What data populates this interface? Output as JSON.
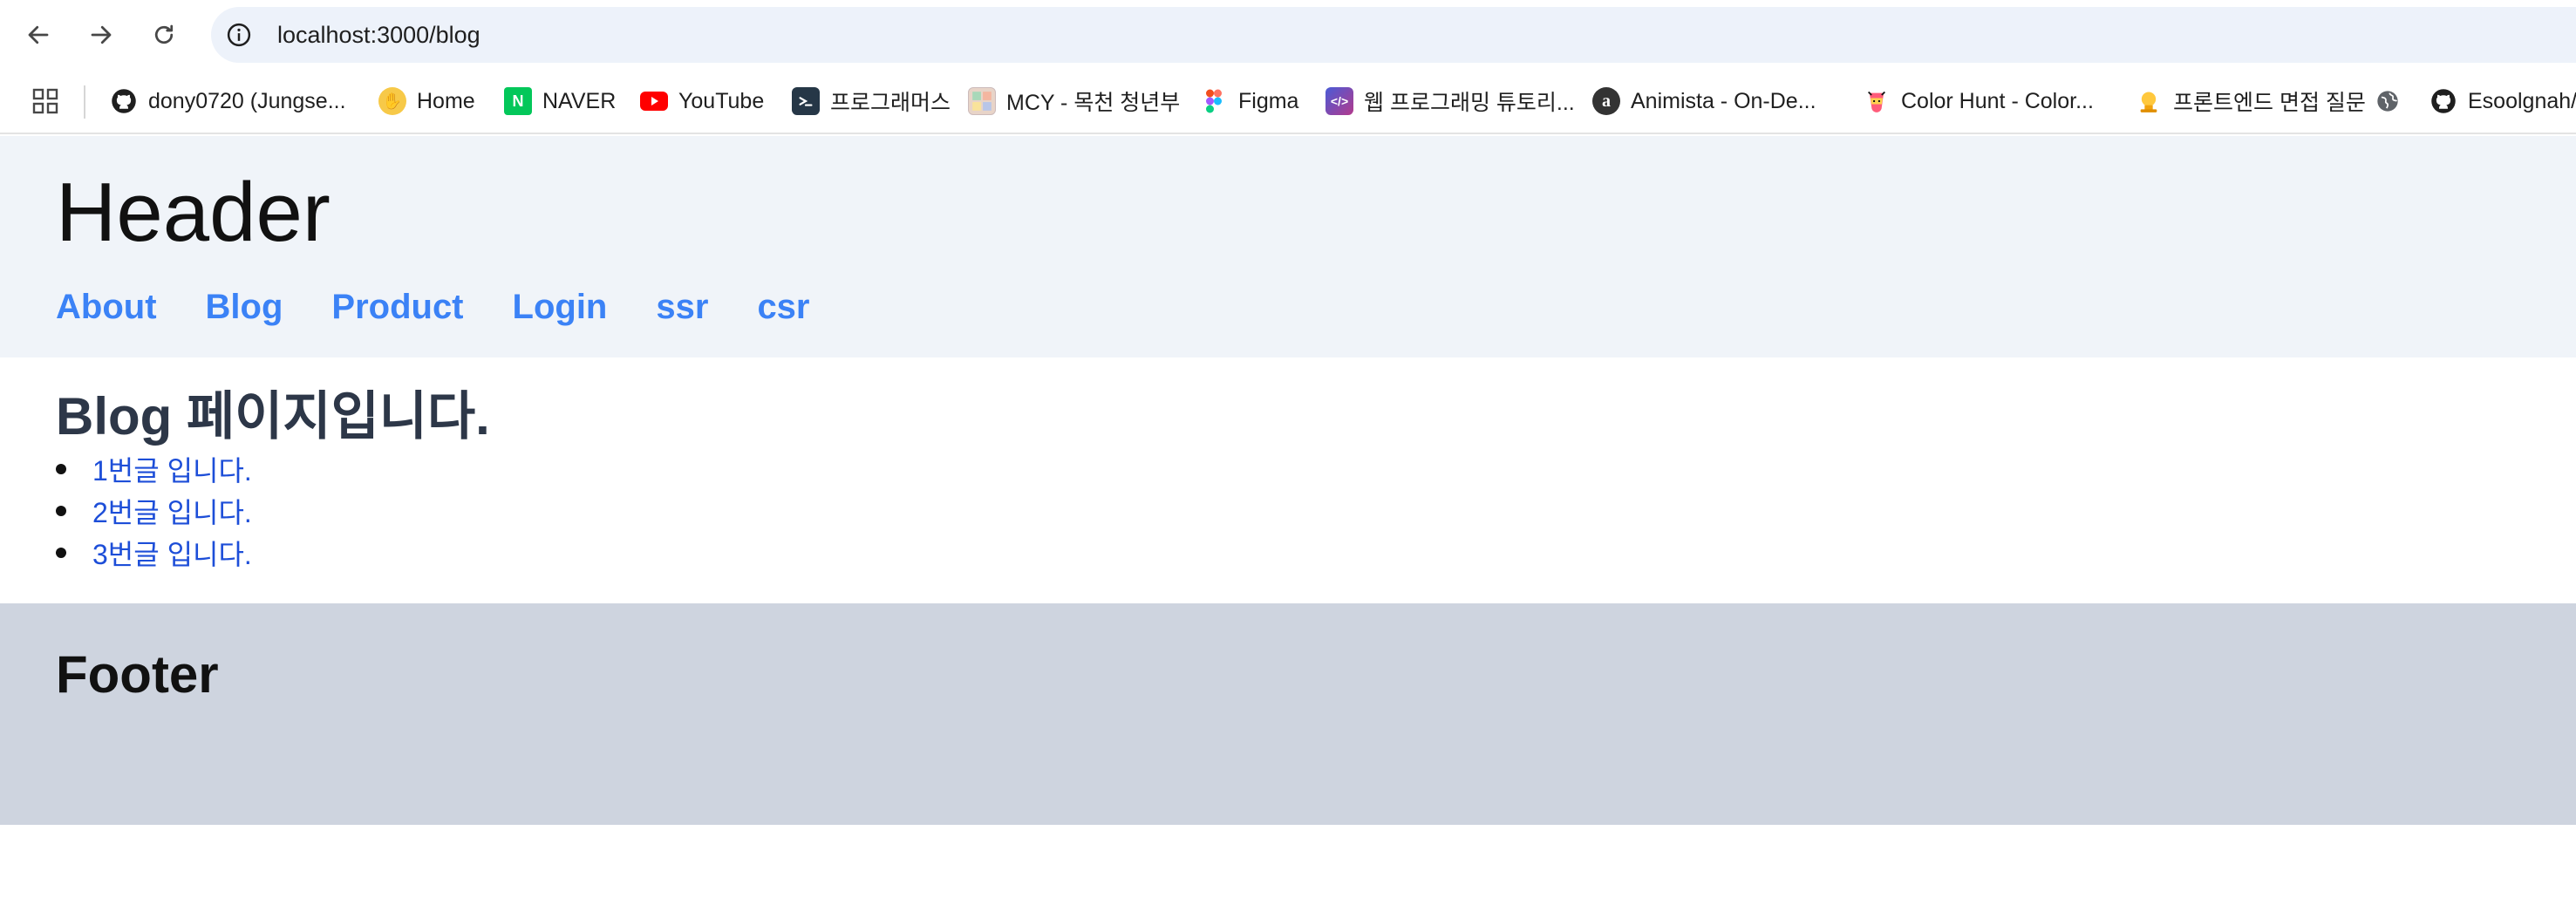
{
  "browser": {
    "url": "localhost:3000/blog"
  },
  "bookmarks": [
    {
      "label": "dony0720 (Jungse...",
      "icon": "github-icon"
    },
    {
      "label": "Home",
      "icon": "waving-hand-icon"
    },
    {
      "label": "NAVER",
      "icon": "naver-icon",
      "color": "#03c75a"
    },
    {
      "label": "YouTube",
      "icon": "youtube-icon",
      "color": "#ff0000"
    },
    {
      "label": "프로그래머스",
      "icon": "programmers-icon",
      "color": "#263747"
    },
    {
      "label": "MCY - 목천 청년부",
      "icon": "mcy-icon"
    },
    {
      "label": "Figma",
      "icon": "figma-icon"
    },
    {
      "label": "웹 프로그래밍 튜토리...",
      "icon": "code-icon",
      "color": "#7b3fa0"
    },
    {
      "label": "Animista - On-De...",
      "icon": "animista-icon",
      "color": "#333333"
    },
    {
      "label": "Color Hunt - Color...",
      "icon": "colorhunt-icon"
    },
    {
      "label": "프론트엔드 면접 질문",
      "icon": "lightbulb-icon"
    },
    {
      "label": "",
      "icon": "globe-icon"
    },
    {
      "label": "Esoolgnah/",
      "icon": "github-icon"
    }
  ],
  "header": {
    "title": "Header",
    "links": [
      "About",
      "Blog",
      "Product",
      "Login",
      "ssr",
      "csr"
    ]
  },
  "main": {
    "heading": "Blog 페이지입니다.",
    "posts": [
      "1번글 입니다.",
      "2번글 입니다.",
      "3번글 입니다."
    ]
  },
  "footer": {
    "title": "Footer"
  },
  "colors": {
    "link": "#3b82f6",
    "post_link": "#1d4ed8",
    "header_bg": "#f0f4f9",
    "footer_bg": "#ced4df"
  }
}
